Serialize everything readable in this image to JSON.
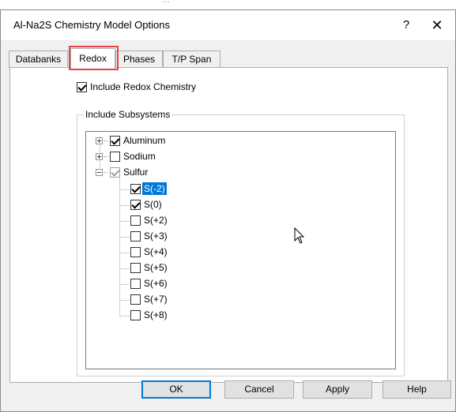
{
  "background_window": {
    "partial_text": "..."
  },
  "dialog": {
    "title": "Al-Na2S  Chemistry Model Options",
    "help_glyph": "?",
    "close_glyph": "✕"
  },
  "tabs": [
    {
      "label": "Databanks",
      "active": false
    },
    {
      "label": "Redox",
      "active": true
    },
    {
      "label": "Phases",
      "active": false
    },
    {
      "label": "T/P Span",
      "active": false
    }
  ],
  "redox": {
    "include_redox_label": "Include Redox Chemistry",
    "include_redox_checked": true,
    "subsystems_group_label": "Include Subsystems",
    "tree": [
      {
        "label": "Aluminum",
        "checked": true,
        "expander": "plus"
      },
      {
        "label": "Sodium",
        "checked": false,
        "expander": "plus"
      },
      {
        "label": "Sulfur",
        "checked": "partial",
        "expander": "minus",
        "children": [
          {
            "label": "S(-2)",
            "checked": true,
            "selected": true
          },
          {
            "label": "S(0)",
            "checked": true,
            "selected": false
          },
          {
            "label": "S(+2)",
            "checked": false,
            "selected": false
          },
          {
            "label": "S(+3)",
            "checked": false,
            "selected": false
          },
          {
            "label": "S(+4)",
            "checked": false,
            "selected": false
          },
          {
            "label": "S(+5)",
            "checked": false,
            "selected": false
          },
          {
            "label": "S(+6)",
            "checked": false,
            "selected": false
          },
          {
            "label": "S(+7)",
            "checked": false,
            "selected": false
          },
          {
            "label": "S(+8)",
            "checked": false,
            "selected": false
          }
        ]
      }
    ]
  },
  "buttons": {
    "ok": "OK",
    "cancel": "Cancel",
    "apply": "Apply",
    "help": "Help"
  },
  "colors": {
    "highlight_box": "#e5414b",
    "selection": "#0078d7",
    "dialog_bg": "#f0f0f0"
  }
}
